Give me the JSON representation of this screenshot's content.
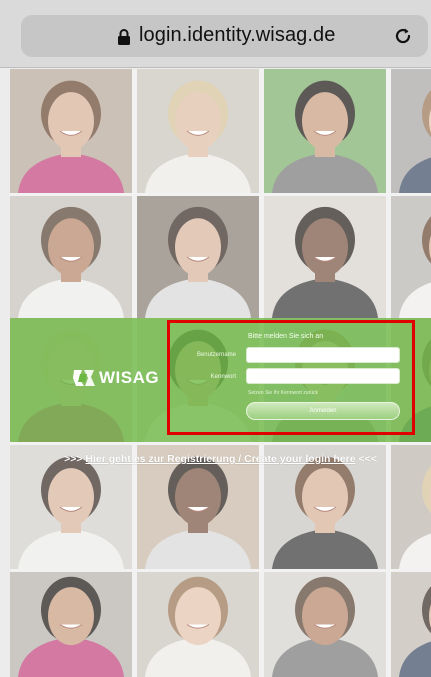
{
  "browser": {
    "url": "login.identity.wisag.de",
    "lock_icon": "lock-icon",
    "reload_icon": "reload-icon"
  },
  "login": {
    "title": "Bitte melden Sie sich an",
    "username_label": "Benutzername",
    "password_label": "Kennwort",
    "forgot_link": "Setzen Sie Ihr Kennwort zurück",
    "submit_label": "Anmelden",
    "username_value": "",
    "password_value": ""
  },
  "brand": {
    "logo_text": "WISAG",
    "band_color": "#6cb742",
    "highlight_color": "#e10000"
  },
  "register": {
    "prefix": ">>> ",
    "link_text": "Hier geht es zur Registrierung / Create your login here",
    "suffix": " <<<"
  }
}
